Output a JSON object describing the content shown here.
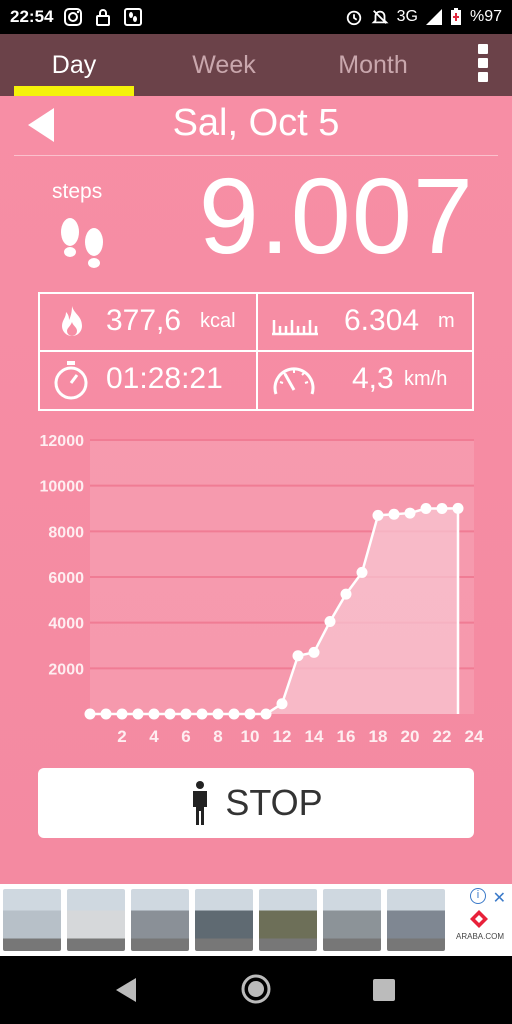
{
  "status_bar": {
    "time": "22:54",
    "network": "3G",
    "battery": "%97",
    "left_icons": [
      "instagram-icon",
      "lock-icon",
      "pedometer-notification-icon"
    ],
    "right_icons": [
      "alarm-icon",
      "notifications-off-icon",
      "signal-icon",
      "battery-icon"
    ]
  },
  "tabs": [
    {
      "label": "Day",
      "active": true
    },
    {
      "label": "Week",
      "active": false
    },
    {
      "label": "Month",
      "active": false
    }
  ],
  "date": {
    "title": "Sal, Oct 5"
  },
  "steps": {
    "label": "steps",
    "value": "9.007"
  },
  "stats": {
    "calories": {
      "value": "377,6",
      "unit": "kcal",
      "icon": "flame-icon"
    },
    "distance": {
      "value": "6.304",
      "unit": "m",
      "icon": "ruler-icon"
    },
    "duration": {
      "value": "01:28:21",
      "icon": "stopwatch-icon"
    },
    "speed": {
      "value": "4,3",
      "unit": "km/h",
      "icon": "speedometer-icon"
    }
  },
  "chart_data": {
    "type": "area",
    "x": [
      0,
      1,
      2,
      3,
      4,
      5,
      6,
      7,
      8,
      9,
      10,
      11,
      12,
      13,
      14,
      15,
      16,
      17,
      18,
      19,
      20,
      21,
      22,
      23
    ],
    "values": [
      0,
      0,
      0,
      0,
      0,
      0,
      0,
      0,
      0,
      0,
      0,
      0,
      450,
      2550,
      2700,
      4050,
      5250,
      6200,
      8700,
      8750,
      8800,
      9000,
      9000,
      9007
    ],
    "yticks": [
      "2000",
      "4000",
      "6000",
      "8000",
      "10000",
      "12000"
    ],
    "xticks": [
      "2",
      "4",
      "6",
      "8",
      "10",
      "12",
      "14",
      "16",
      "18",
      "20",
      "22",
      "24"
    ],
    "xlim": [
      0,
      24
    ],
    "ylim": [
      0,
      12000
    ],
    "grid": true,
    "colors": {
      "fill": "#f8c4d0",
      "line": "#ffffff",
      "grid": "#f07c94"
    }
  },
  "stop_button": {
    "label": "STOP",
    "icon": "person-standing-icon"
  },
  "ad": {
    "brand": "ARABA.COM",
    "thumb_colors": [
      "#b7c0c8",
      "#d6d8da",
      "#8a9097",
      "#5f6a72",
      "#6d6f58",
      "#8c9398",
      "#7f8792"
    ],
    "icons": [
      "ad-info-icon",
      "ad-close-icon"
    ]
  },
  "nav": {
    "icons": [
      "back-icon",
      "home-icon",
      "recents-icon"
    ]
  }
}
